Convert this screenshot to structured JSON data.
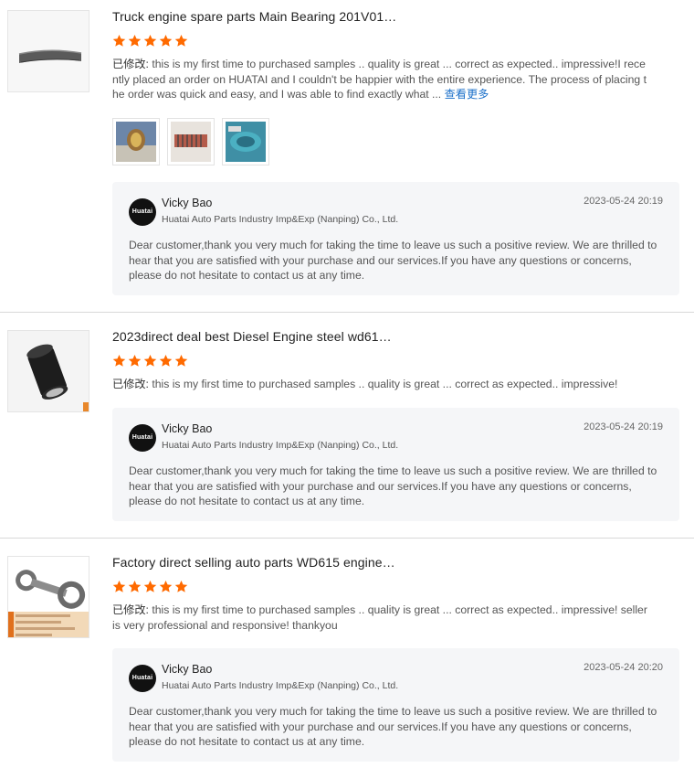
{
  "reviews": [
    {
      "title": "Truck engine spare parts Main Bearing 201V01…",
      "rating": 5,
      "comment_prefix": "已修改:",
      "comment": " this is my first time to purchased samples .. quality is great ... correct as expected.. impressive!I recently placed an order on HUATAI and I couldn't be happier with the entire experience. The process of placing the order was quick and easy, and I was able to find exactly what ... ",
      "more_label": "查看更多",
      "photos": [
        "photo-1",
        "photo-2",
        "photo-3"
      ],
      "reply": {
        "avatar_text": "Huatai",
        "seller": "Vicky Bao",
        "company": "Huatai Auto Parts Industry Imp&Exp (Nanping) Co., Ltd.",
        "date": "2023-05-24 20:19",
        "text": "Dear customer,thank you very much for taking the time to leave us such a positive review. We are thrilled to hear that you are satisfied with your purchase and our services.If you have any questions or concerns, please do not hesitate to contact us at any time."
      }
    },
    {
      "title": "2023direct deal best Diesel Engine steel wd61…",
      "rating": 5,
      "comment_prefix": "已修改:",
      "comment": " this is my first time to purchased samples .. quality is great ... correct as expected.. impressive!",
      "reply": {
        "avatar_text": "Huatai",
        "seller": "Vicky Bao",
        "company": "Huatai Auto Parts Industry Imp&Exp (Nanping) Co., Ltd.",
        "date": "2023-05-24 20:19",
        "text": "Dear customer,thank you very much for taking the time to leave us such a positive review. We are thrilled to hear that you are satisfied with your purchase and our services.If you have any questions or concerns, please do not hesitate to contact us at any time."
      }
    },
    {
      "title": "Factory direct selling auto parts WD615 engine…",
      "rating": 5,
      "comment_prefix": "已修改:",
      "comment": " this is my first time to purchased samples .. quality is great ... correct as expected.. impressive!  seller is very professional and responsive! thankyou",
      "reply": {
        "avatar_text": "Huatai",
        "seller": "Vicky Bao",
        "company": "Huatai Auto Parts Industry Imp&Exp (Nanping) Co., Ltd.",
        "date": "2023-05-24 20:20",
        "text": "Dear customer,thank you very much for taking the time to leave us such a positive review. We are thrilled to hear that you are satisfied with your purchase and our services.If you have any questions or concerns, please do not hesitate to contact us at any time."
      }
    }
  ],
  "colors": {
    "star": "#ff6a00",
    "link": "#1a6fc9",
    "reply_bg": "#f5f6f8"
  },
  "icons": {
    "star": "star-icon"
  }
}
